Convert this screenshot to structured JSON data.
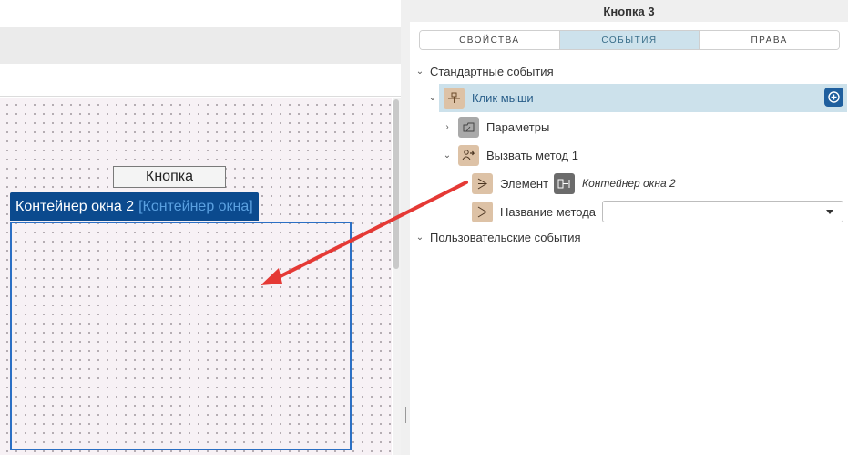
{
  "designer": {
    "button_widget_label": "Кнопка",
    "container_name": "Контейнер окна 2",
    "container_type": "[Контейнер окна]"
  },
  "panel": {
    "title": "Кнопка 3",
    "tabs": [
      {
        "label": "СВОЙСТВА",
        "active": false
      },
      {
        "label": "СОБЫТИЯ",
        "active": true
      },
      {
        "label": "ПРАВА",
        "active": false
      }
    ],
    "tree": {
      "standard_events": "Стандартные события",
      "mouse_click": "Клик мыши",
      "parameters": "Параметры",
      "call_method": "Вызвать метод 1",
      "element_label": "Элемент",
      "element_value": "Контейнер окна 2",
      "method_name_label": "Название метода",
      "method_name_value": "",
      "user_events": "Пользовательские события"
    }
  },
  "colors": {
    "accent_blue": "#0b4a8e",
    "selection": "#cce1eb",
    "arrow": "#e53935"
  }
}
